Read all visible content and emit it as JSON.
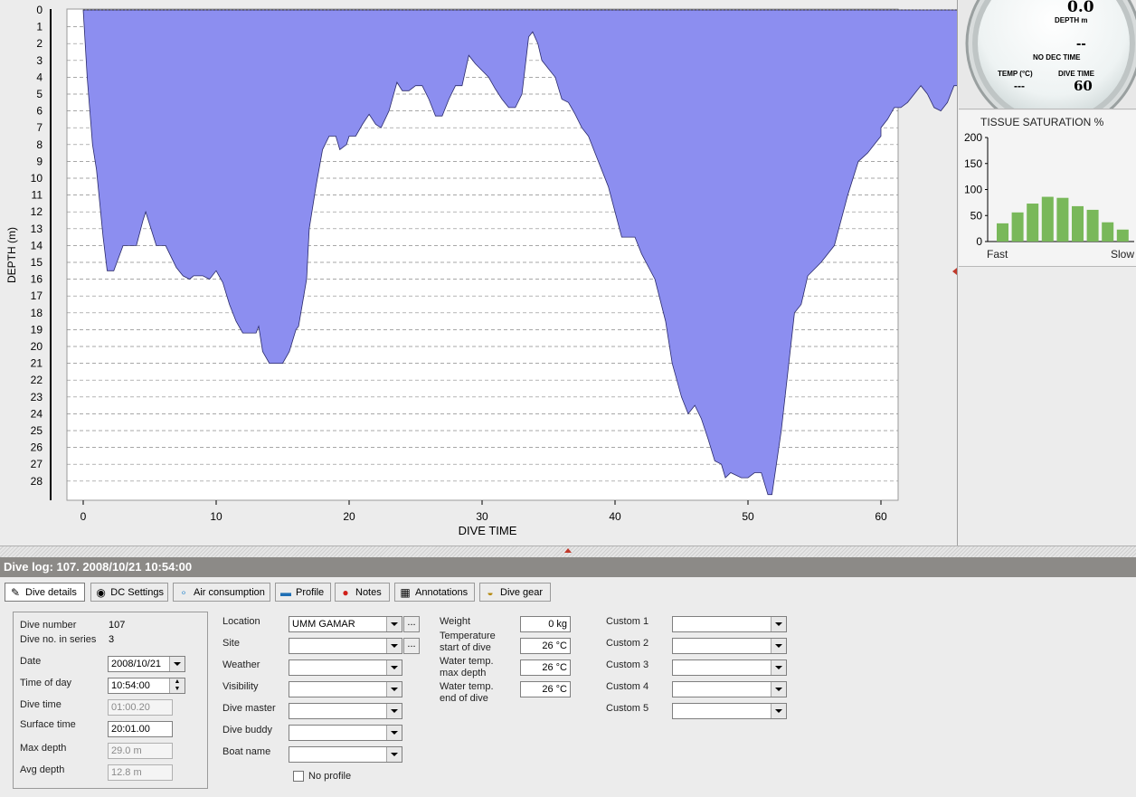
{
  "profile": {
    "xlabel": "DIVE TIME",
    "ylabel": "DEPTH (m)",
    "x_ticks": [
      "0",
      "10",
      "20",
      "30",
      "40",
      "50",
      "60"
    ],
    "y_ticks": [
      "0",
      "1",
      "2",
      "3",
      "4",
      "5",
      "6",
      "7",
      "8",
      "9",
      "10",
      "11",
      "12",
      "13",
      "14",
      "15",
      "16",
      "17",
      "18",
      "19",
      "20",
      "21",
      "22",
      "23",
      "24",
      "25",
      "26",
      "27",
      "28"
    ],
    "fill_color": "#8c8ef0",
    "xlim": [
      0,
      61.5
    ],
    "ylim": [
      0,
      29
    ],
    "points": [
      [
        0,
        0
      ],
      [
        0.3,
        4
      ],
      [
        0.7,
        8
      ],
      [
        1,
        9.5
      ],
      [
        1.5,
        13.5
      ],
      [
        1.8,
        15.5
      ],
      [
        2.3,
        15.5
      ],
      [
        3,
        14
      ],
      [
        4,
        14
      ],
      [
        4.5,
        12.5
      ],
      [
        4.7,
        12
      ],
      [
        5.5,
        14
      ],
      [
        6.2,
        14
      ],
      [
        7,
        15.3
      ],
      [
        7.5,
        15.8
      ],
      [
        8,
        16
      ],
      [
        8.3,
        15.8
      ],
      [
        9,
        15.8
      ],
      [
        9.5,
        16
      ],
      [
        10,
        15.5
      ],
      [
        10.5,
        16.2
      ],
      [
        11,
        17.5
      ],
      [
        11.5,
        18.5
      ],
      [
        12,
        19.2
      ],
      [
        13,
        19.2
      ],
      [
        13.2,
        18.8
      ],
      [
        13.5,
        20.3
      ],
      [
        14,
        21
      ],
      [
        15,
        21
      ],
      [
        15.5,
        20.3
      ],
      [
        16,
        19
      ],
      [
        16.2,
        18.8
      ],
      [
        16.8,
        16
      ],
      [
        17,
        13
      ],
      [
        17.5,
        10.5
      ],
      [
        18,
        8.3
      ],
      [
        18.5,
        7.5
      ],
      [
        19,
        7.5
      ],
      [
        19.3,
        8.3
      ],
      [
        19.8,
        8
      ],
      [
        20,
        7.5
      ],
      [
        20.5,
        7.5
      ],
      [
        21,
        6.8
      ],
      [
        21.5,
        6.2
      ],
      [
        22,
        6.8
      ],
      [
        22.4,
        7
      ],
      [
        23,
        6
      ],
      [
        23.6,
        4.3
      ],
      [
        24,
        4.8
      ],
      [
        24.5,
        4.8
      ],
      [
        25,
        4.5
      ],
      [
        25.5,
        4.5
      ],
      [
        26,
        5.3
      ],
      [
        26.5,
        6.3
      ],
      [
        27,
        6.3
      ],
      [
        27.5,
        5.3
      ],
      [
        28,
        4.5
      ],
      [
        28.5,
        4.5
      ],
      [
        29,
        2.7
      ],
      [
        29.5,
        3.2
      ],
      [
        30,
        3.6
      ],
      [
        30.5,
        4
      ],
      [
        31,
        4.7
      ],
      [
        31.5,
        5.3
      ],
      [
        32,
        5.8
      ],
      [
        32.5,
        5.8
      ],
      [
        33,
        5
      ],
      [
        33.5,
        1.6
      ],
      [
        33.8,
        1.3
      ],
      [
        34.2,
        2
      ],
      [
        34.5,
        3
      ],
      [
        35,
        3.5
      ],
      [
        35.5,
        4
      ],
      [
        36,
        5.3
      ],
      [
        36.5,
        5.5
      ],
      [
        37,
        6.2
      ],
      [
        37.5,
        7
      ],
      [
        38,
        7.5
      ],
      [
        38.5,
        8.5
      ],
      [
        39.5,
        10.5
      ],
      [
        40.5,
        13.5
      ],
      [
        41.5,
        13.5
      ],
      [
        42,
        14.5
      ],
      [
        43,
        16
      ],
      [
        43.8,
        18.5
      ],
      [
        44.3,
        21
      ],
      [
        45,
        23
      ],
      [
        45.5,
        24
      ],
      [
        46,
        23.5
      ],
      [
        46.5,
        24.3
      ],
      [
        47,
        25.5
      ],
      [
        47.5,
        26.8
      ],
      [
        48,
        27
      ],
      [
        48.3,
        27.8
      ],
      [
        48.7,
        27.5
      ],
      [
        49.5,
        27.8
      ],
      [
        50,
        27.8
      ],
      [
        50.5,
        27.5
      ],
      [
        51,
        27.5
      ],
      [
        51.5,
        28.8
      ],
      [
        51.8,
        28.8
      ],
      [
        52.5,
        25
      ],
      [
        53.5,
        18
      ],
      [
        54,
        17.5
      ],
      [
        54.5,
        15.8
      ],
      [
        55.5,
        15
      ],
      [
        56.5,
        14
      ],
      [
        57.5,
        11
      ],
      [
        58.3,
        9
      ],
      [
        59,
        8.5
      ],
      [
        59.5,
        8
      ],
      [
        60,
        7.5
      ],
      [
        60,
        7
      ],
      [
        60.5,
        6.5
      ],
      [
        61,
        5.8
      ],
      [
        61.5,
        5.8
      ],
      [
        62,
        5.5
      ],
      [
        62.5,
        5
      ],
      [
        63,
        4.5
      ],
      [
        63.5,
        5
      ],
      [
        64,
        5.8
      ],
      [
        64.5,
        6
      ],
      [
        65,
        5.5
      ],
      [
        65.5,
        4.5
      ],
      [
        66,
        4.5
      ]
    ],
    "x_end": 66
  },
  "gauge": {
    "depth_value": "0.0",
    "depth_label": "DEPTH m",
    "dash": "--",
    "nodec": "NO DEC TIME",
    "temp_label": "TEMP (°C)",
    "temp_value": "---",
    "divetime_label": "DIVE TIME",
    "divetime_value": "60"
  },
  "tissue": {
    "title": "TISSUE SATURATION %",
    "y_ticks": [
      "200",
      "150",
      "100",
      "50",
      "0"
    ],
    "values": [
      35,
      56,
      73,
      86,
      84,
      68,
      61,
      37,
      23
    ],
    "color": "#79b85a",
    "fast_label": "Fast",
    "slow_label": "Slow"
  },
  "log_header": "Dive log: 107. 2008/10/21 10:54:00",
  "tabs": [
    {
      "label": "Dive details",
      "icon": "pencil-icon",
      "glyph": "✎"
    },
    {
      "label": "DC Settings",
      "icon": "dive-computer-icon",
      "glyph": "◉"
    },
    {
      "label": "Air consumption",
      "icon": "bubbles-icon",
      "glyph": "∘"
    },
    {
      "label": "Profile",
      "icon": "profile-icon",
      "glyph": "▬"
    },
    {
      "label": "Notes",
      "icon": "pin-icon",
      "glyph": "●"
    },
    {
      "label": "Annotations",
      "icon": "film-icon",
      "glyph": "▦"
    },
    {
      "label": "Dive gear",
      "icon": "mask-icon",
      "glyph": "◒"
    }
  ],
  "details": {
    "dive_number_label": "Dive number",
    "dive_number": "107",
    "series_label": "Dive no. in series",
    "series": "3",
    "date_label": "Date",
    "date": "2008/10/21",
    "time_label": "Time of day",
    "time": "10:54:00",
    "divetime_label": "Dive time",
    "divetime": "01:00.20",
    "surface_label": "Surface time",
    "surface": "20:01.00",
    "maxdepth_label": "Max depth",
    "maxdepth": "29.0 m",
    "avgdepth_label": "Avg depth",
    "avgdepth": "12.8 m"
  },
  "site": {
    "location_label": "Location",
    "location": "UMM GAMAR",
    "site_label": "Site",
    "weather_label": "Weather",
    "visibility_label": "Visibility",
    "divemaster_label": "Dive master",
    "buddy_label": "Dive buddy",
    "boat_label": "Boat name",
    "noprofile_label": "No profile",
    "dots": "..."
  },
  "conditions": {
    "weight_label": "Weight",
    "weight": "0 kg",
    "temp_start_label_1": "Temperature",
    "temp_start_label_2": "start of dive",
    "temp_start": "26 °C",
    "temp_max_label_1": "Water temp.",
    "temp_max_label_2": "max depth",
    "temp_max": "26 °C",
    "temp_end_label_1": "Water temp.",
    "temp_end_label_2": "end of dive",
    "temp_end": "26 °C"
  },
  "custom": {
    "c1": "Custom 1",
    "c2": "Custom 2",
    "c3": "Custom 3",
    "c4": "Custom 4",
    "c5": "Custom 5"
  }
}
